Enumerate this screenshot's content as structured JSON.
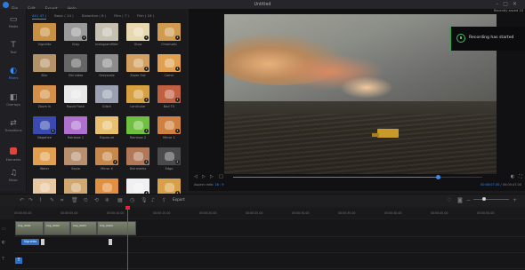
{
  "app": {
    "title": "Untitled",
    "menu": [
      "File",
      "Edit",
      "Export",
      "Help"
    ]
  },
  "sidebar": {
    "items": [
      {
        "label": "Media",
        "icon": "▭"
      },
      {
        "label": "Text",
        "icon": "T"
      },
      {
        "label": "Filters",
        "icon": "◐"
      },
      {
        "label": "Overlays",
        "icon": "◧"
      },
      {
        "label": "Transitions",
        "icon": "⇄"
      },
      {
        "label": "Elements",
        "icon": "■"
      },
      {
        "label": "Music",
        "icon": "♫"
      }
    ]
  },
  "tabs": [
    "All ( 47 )",
    "Basic ( 14 )",
    "Distortion ( 8 )",
    "Film ( 7 )",
    "Film ( 18 )"
  ],
  "filters": [
    {
      "name": "Vignette",
      "color": "#c89042"
    },
    {
      "name": "Gray",
      "color": "#9a9a9a"
    },
    {
      "name": "Instagramfilter",
      "color": "#c5c0b0"
    },
    {
      "name": "Glow",
      "color": "#e8d8b0"
    },
    {
      "name": "Chromatic",
      "color": "#d09a50"
    },
    {
      "name": "Blur",
      "color": "#b49268"
    },
    {
      "name": "Old video",
      "color": "#666"
    },
    {
      "name": "Greyscale",
      "color": "#8c8c8c"
    },
    {
      "name": "Zoom Out",
      "color": "#d4a060"
    },
    {
      "name": "Comic",
      "color": "#e0a050"
    },
    {
      "name": "Zoom In",
      "color": "#d49048"
    },
    {
      "name": "Rapid Flash",
      "color": "#e8e8e8"
    },
    {
      "name": "Glitch",
      "color": "#9aa0b0"
    },
    {
      "name": "Lenticular",
      "color": "#d8a040"
    },
    {
      "name": "Bad TV",
      "color": "#c06040"
    },
    {
      "name": "Negative",
      "color": "#3a4ab0"
    },
    {
      "name": "Rainbow 1",
      "color": "#b070d0"
    },
    {
      "name": "Exposure",
      "color": "#e8c070"
    },
    {
      "name": "Rainbow 2",
      "color": "#70c040"
    },
    {
      "name": "Mirror 1",
      "color": "#d08040"
    },
    {
      "name": "Water",
      "color": "#e0a050"
    },
    {
      "name": "Sepia",
      "color": "#b89070"
    },
    {
      "name": "Mirror X",
      "color": "#c8884a"
    },
    {
      "name": "Dot matrix",
      "color": "#b07858"
    },
    {
      "name": "Edge",
      "color": "#4a4a4a"
    },
    {
      "name": "",
      "color": "#e8c8a0"
    },
    {
      "name": "",
      "color": "#d0a870"
    },
    {
      "name": "",
      "color": "#e09040"
    },
    {
      "name": "",
      "color": "#f0f0f0"
    },
    {
      "name": "",
      "color": "#d8a048"
    }
  ],
  "player": {
    "toast": "Recording has started",
    "rec_badge": "Recently saved 10",
    "aspect_label": "Aspect ratio:",
    "aspect_value": "16 : 9",
    "time_current": "00:00:07.00",
    "time_total": "00:00:47.00",
    "progress_fraction": 0.82
  },
  "toolbar": {
    "export_label": "Export"
  },
  "timeline": {
    "ticks": [
      "00:00:00.00",
      "00:00:05.00",
      "00:00:10.00",
      "00:00:15.00",
      "00:00:20.00",
      "00:00:25.00",
      "00:00:30.00",
      "00:00:35.00",
      "00:00:40.00",
      "00:00:45.00",
      "00:00:50.00"
    ],
    "clips": [
      "Clip_0001",
      "Clip_0002",
      "Clip_0003",
      "Clip_0004"
    ],
    "fx_label": "Vignette",
    "text_track_label": "T"
  }
}
